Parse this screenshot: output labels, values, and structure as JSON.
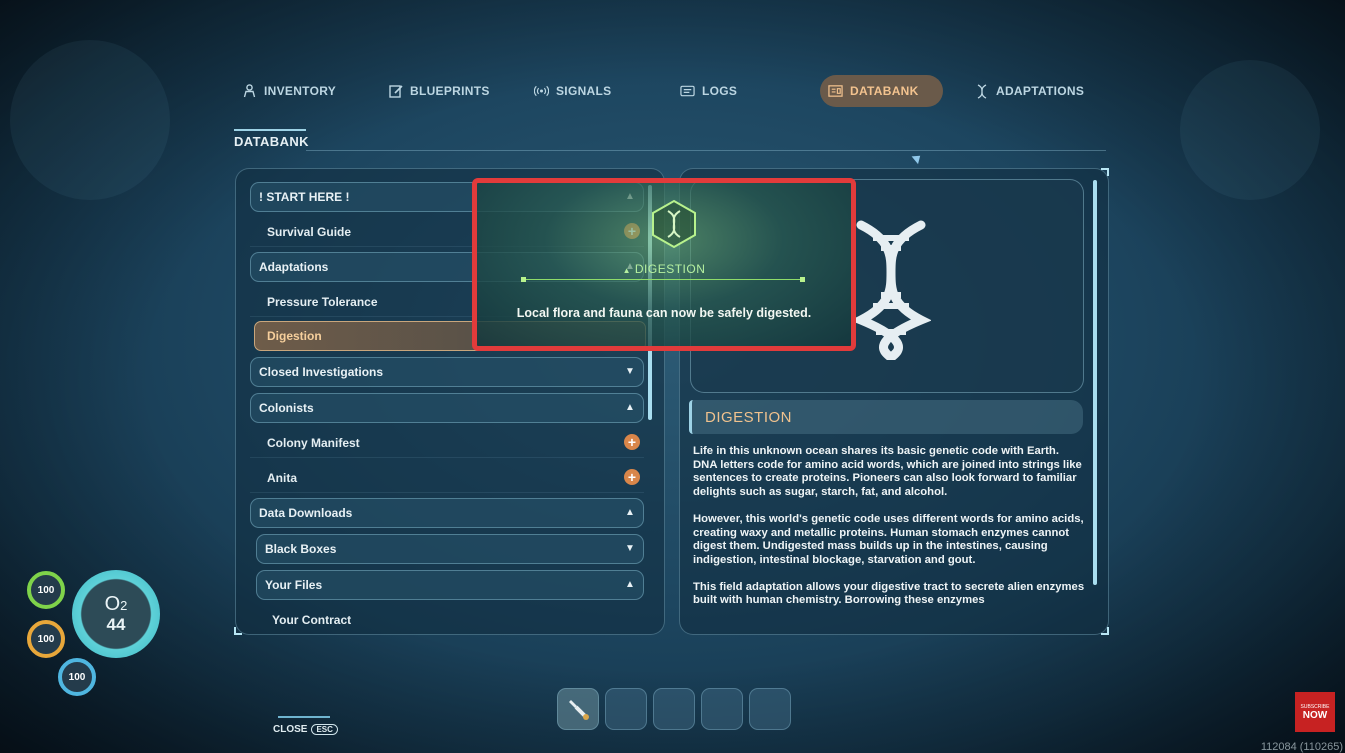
{
  "tabs": [
    {
      "label": "INVENTORY",
      "icon": "person-icon"
    },
    {
      "label": "BLUEPRINTS",
      "icon": "blueprint-icon"
    },
    {
      "label": "SIGNALS",
      "icon": "signal-icon"
    },
    {
      "label": "LOGS",
      "icon": "log-icon"
    },
    {
      "label": "DATABANK",
      "icon": "databank-icon",
      "active": true
    },
    {
      "label": "ADAPTATIONS",
      "icon": "dna-icon"
    }
  ],
  "section_title": "DATABANK",
  "entries": [
    {
      "label": "! START HERE !",
      "type": "category",
      "expanded": true
    },
    {
      "label": "Survival Guide",
      "type": "item",
      "new": true
    },
    {
      "label": "Adaptations",
      "type": "category",
      "expanded": true
    },
    {
      "label": "Pressure Tolerance",
      "type": "item"
    },
    {
      "label": "Digestion",
      "type": "item",
      "selected": true
    },
    {
      "label": "Closed Investigations",
      "type": "category",
      "expanded": false
    },
    {
      "label": "Colonists",
      "type": "category",
      "expanded": true
    },
    {
      "label": "Colony Manifest",
      "type": "item",
      "new": true
    },
    {
      "label": "Anita",
      "type": "item",
      "new": true
    },
    {
      "label": "Data Downloads",
      "type": "category",
      "expanded": true
    },
    {
      "label": "Black Boxes",
      "type": "subcategory",
      "expanded": false
    },
    {
      "label": "Your Files",
      "type": "subcategory",
      "expanded": true
    },
    {
      "label": "Your Contract",
      "type": "item"
    }
  ],
  "detail": {
    "title": "DIGESTION",
    "paragraphs": [
      "Life in this unknown ocean shares its basic genetic code with Earth. DNA letters code for amino acid words, which are joined into strings like sentences to create proteins. Pioneers can also look forward to familiar delights such as sugar, starch, fat, and alcohol.",
      "However, this world's genetic code uses different words for amino acids, creating waxy and metallic proteins. Human stomach enzymes cannot digest them. Undigested mass builds up in the intestines, causing indigestion, intestinal blockage, starvation and gout.",
      "This field adaptation allows your digestive tract to secrete alien enzymes built with human chemistry. Borrowing these enzymes"
    ]
  },
  "popup": {
    "title": "DIGESTION",
    "text": "Local flora and fauna can now be safely digested.",
    "icon": "dna-hex-icon"
  },
  "hud": {
    "health": "100",
    "food": "100",
    "water": "100",
    "o2_label": "O",
    "o2_sub": "2",
    "o2_value": "44",
    "health_color": "#7fd34a",
    "food_color": "#e8a73a",
    "water_color": "#4fb6e0"
  },
  "close_label": "CLOSE",
  "close_key": "ESC",
  "subscribe": {
    "top": "SUBSCRIBE",
    "label": "NOW"
  },
  "build": "112084 (110265)",
  "colors": {
    "accent": "#f3c38f",
    "panel_border": "#9ed3e6",
    "popup_border": "#e23b3b"
  }
}
